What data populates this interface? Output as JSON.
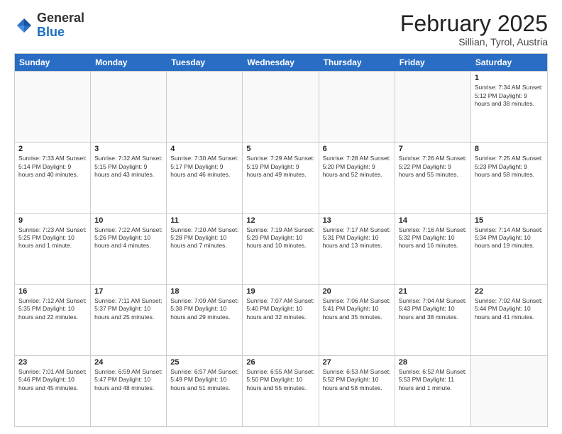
{
  "logo": {
    "general": "General",
    "blue": "Blue"
  },
  "header": {
    "month": "February 2025",
    "location": "Sillian, Tyrol, Austria"
  },
  "days": [
    "Sunday",
    "Monday",
    "Tuesday",
    "Wednesday",
    "Thursday",
    "Friday",
    "Saturday"
  ],
  "weeks": [
    [
      {
        "day": "",
        "info": ""
      },
      {
        "day": "",
        "info": ""
      },
      {
        "day": "",
        "info": ""
      },
      {
        "day": "",
        "info": ""
      },
      {
        "day": "",
        "info": ""
      },
      {
        "day": "",
        "info": ""
      },
      {
        "day": "1",
        "info": "Sunrise: 7:34 AM\nSunset: 5:12 PM\nDaylight: 9 hours and 38 minutes."
      }
    ],
    [
      {
        "day": "2",
        "info": "Sunrise: 7:33 AM\nSunset: 5:14 PM\nDaylight: 9 hours and 40 minutes."
      },
      {
        "day": "3",
        "info": "Sunrise: 7:32 AM\nSunset: 5:15 PM\nDaylight: 9 hours and 43 minutes."
      },
      {
        "day": "4",
        "info": "Sunrise: 7:30 AM\nSunset: 5:17 PM\nDaylight: 9 hours and 46 minutes."
      },
      {
        "day": "5",
        "info": "Sunrise: 7:29 AM\nSunset: 5:19 PM\nDaylight: 9 hours and 49 minutes."
      },
      {
        "day": "6",
        "info": "Sunrise: 7:28 AM\nSunset: 5:20 PM\nDaylight: 9 hours and 52 minutes."
      },
      {
        "day": "7",
        "info": "Sunrise: 7:26 AM\nSunset: 5:22 PM\nDaylight: 9 hours and 55 minutes."
      },
      {
        "day": "8",
        "info": "Sunrise: 7:25 AM\nSunset: 5:23 PM\nDaylight: 9 hours and 58 minutes."
      }
    ],
    [
      {
        "day": "9",
        "info": "Sunrise: 7:23 AM\nSunset: 5:25 PM\nDaylight: 10 hours and 1 minute."
      },
      {
        "day": "10",
        "info": "Sunrise: 7:22 AM\nSunset: 5:26 PM\nDaylight: 10 hours and 4 minutes."
      },
      {
        "day": "11",
        "info": "Sunrise: 7:20 AM\nSunset: 5:28 PM\nDaylight: 10 hours and 7 minutes."
      },
      {
        "day": "12",
        "info": "Sunrise: 7:19 AM\nSunset: 5:29 PM\nDaylight: 10 hours and 10 minutes."
      },
      {
        "day": "13",
        "info": "Sunrise: 7:17 AM\nSunset: 5:31 PM\nDaylight: 10 hours and 13 minutes."
      },
      {
        "day": "14",
        "info": "Sunrise: 7:16 AM\nSunset: 5:32 PM\nDaylight: 10 hours and 16 minutes."
      },
      {
        "day": "15",
        "info": "Sunrise: 7:14 AM\nSunset: 5:34 PM\nDaylight: 10 hours and 19 minutes."
      }
    ],
    [
      {
        "day": "16",
        "info": "Sunrise: 7:12 AM\nSunset: 5:35 PM\nDaylight: 10 hours and 22 minutes."
      },
      {
        "day": "17",
        "info": "Sunrise: 7:11 AM\nSunset: 5:37 PM\nDaylight: 10 hours and 25 minutes."
      },
      {
        "day": "18",
        "info": "Sunrise: 7:09 AM\nSunset: 5:38 PM\nDaylight: 10 hours and 29 minutes."
      },
      {
        "day": "19",
        "info": "Sunrise: 7:07 AM\nSunset: 5:40 PM\nDaylight: 10 hours and 32 minutes."
      },
      {
        "day": "20",
        "info": "Sunrise: 7:06 AM\nSunset: 5:41 PM\nDaylight: 10 hours and 35 minutes."
      },
      {
        "day": "21",
        "info": "Sunrise: 7:04 AM\nSunset: 5:43 PM\nDaylight: 10 hours and 38 minutes."
      },
      {
        "day": "22",
        "info": "Sunrise: 7:02 AM\nSunset: 5:44 PM\nDaylight: 10 hours and 41 minutes."
      }
    ],
    [
      {
        "day": "23",
        "info": "Sunrise: 7:01 AM\nSunset: 5:46 PM\nDaylight: 10 hours and 45 minutes."
      },
      {
        "day": "24",
        "info": "Sunrise: 6:59 AM\nSunset: 5:47 PM\nDaylight: 10 hours and 48 minutes."
      },
      {
        "day": "25",
        "info": "Sunrise: 6:57 AM\nSunset: 5:49 PM\nDaylight: 10 hours and 51 minutes."
      },
      {
        "day": "26",
        "info": "Sunrise: 6:55 AM\nSunset: 5:50 PM\nDaylight: 10 hours and 55 minutes."
      },
      {
        "day": "27",
        "info": "Sunrise: 6:53 AM\nSunset: 5:52 PM\nDaylight: 10 hours and 58 minutes."
      },
      {
        "day": "28",
        "info": "Sunrise: 6:52 AM\nSunset: 5:53 PM\nDaylight: 11 hours and 1 minute."
      },
      {
        "day": "",
        "info": ""
      }
    ]
  ]
}
